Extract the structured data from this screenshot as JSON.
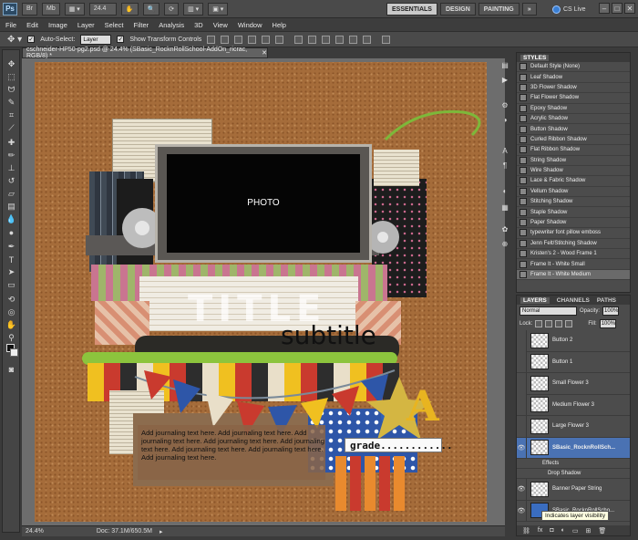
{
  "app": {
    "logo": "Ps",
    "zoom_display": "24.4",
    "workspaces": [
      "ESSENTIALS",
      "DESIGN",
      "PAINTING"
    ],
    "more": "»",
    "cs_live": "CS Live"
  },
  "menu": [
    "File",
    "Edit",
    "Image",
    "Layer",
    "Select",
    "Filter",
    "Analysis",
    "3D",
    "View",
    "Window",
    "Help"
  ],
  "options_bar": {
    "auto_select_label": "Auto-Select:",
    "auto_select_value": "Layer",
    "transform_controls_label": "Show Transform Controls"
  },
  "document": {
    "tab_title": "cschneider-HP50-pg2.psd @ 24.4% (SBasic_RocknRollSchool-AddOn_ricrac, RGB/8) *",
    "status_zoom": "24.4%",
    "status_doc": "Doc: 37.1M/650.5M",
    "photo_label": "PHOTO",
    "title_text": "TITLE",
    "subtitle_text": "subtitle",
    "journal_text": "Add journaling text here.  Add journaling text here. Add journaling text here.  Add journaling text here. Add journaling text here.  Add journaling text here. Add journaling text here.  Add journaling text here.",
    "grade_text": "grade............",
    "letter": "A"
  },
  "styles_panel": {
    "tab": "STYLES",
    "items": [
      "Default Style (None)",
      "Leaf Shadow",
      "3D Flower Shadow",
      "Flat Flower Shadow",
      "Epoxy Shadow",
      "Acrylic Shadow",
      "Button Shadow",
      "Curled Ribbon Shadow",
      "Flat Ribbon Shadow",
      "String Shadow",
      "Wire Shadow",
      "Lace & Fabric Shadow",
      "Vellum Shadow",
      "Stitching Shadow",
      "Staple Shadow",
      "Paper Shadow",
      "typewriter font pillow emboss",
      "Jenn Felt/Stitching Shadow",
      "Kristen's 2 - Wood Frame 1",
      "Frame It - White Small",
      "Frame It - White Medium"
    ]
  },
  "layers_panel": {
    "tabs": [
      "LAYERS",
      "CHANNELS",
      "PATHS"
    ],
    "blend_mode": "Normal",
    "opacity_label": "Opacity:",
    "opacity_value": "100%",
    "lock_label": "Lock:",
    "fill_label": "Fill:",
    "fill_value": "100%",
    "layers": [
      {
        "name": "Button 2",
        "selected": false
      },
      {
        "name": "Button 1",
        "selected": false
      },
      {
        "name": "Small Flower 3",
        "selected": false
      },
      {
        "name": "Medium Flower 3",
        "selected": false
      },
      {
        "name": "Large Flower 3",
        "selected": false
      },
      {
        "name": "SBasic_RocknRollSch...",
        "selected": true
      }
    ],
    "effects_label": "Effects",
    "drop_shadow_label": "Drop Shadow",
    "layers_after": [
      {
        "name": "Banner Paper String"
      },
      {
        "name": "SBasic_RocknRollScho..."
      }
    ],
    "tooltip": "Indicates layer visibility"
  }
}
